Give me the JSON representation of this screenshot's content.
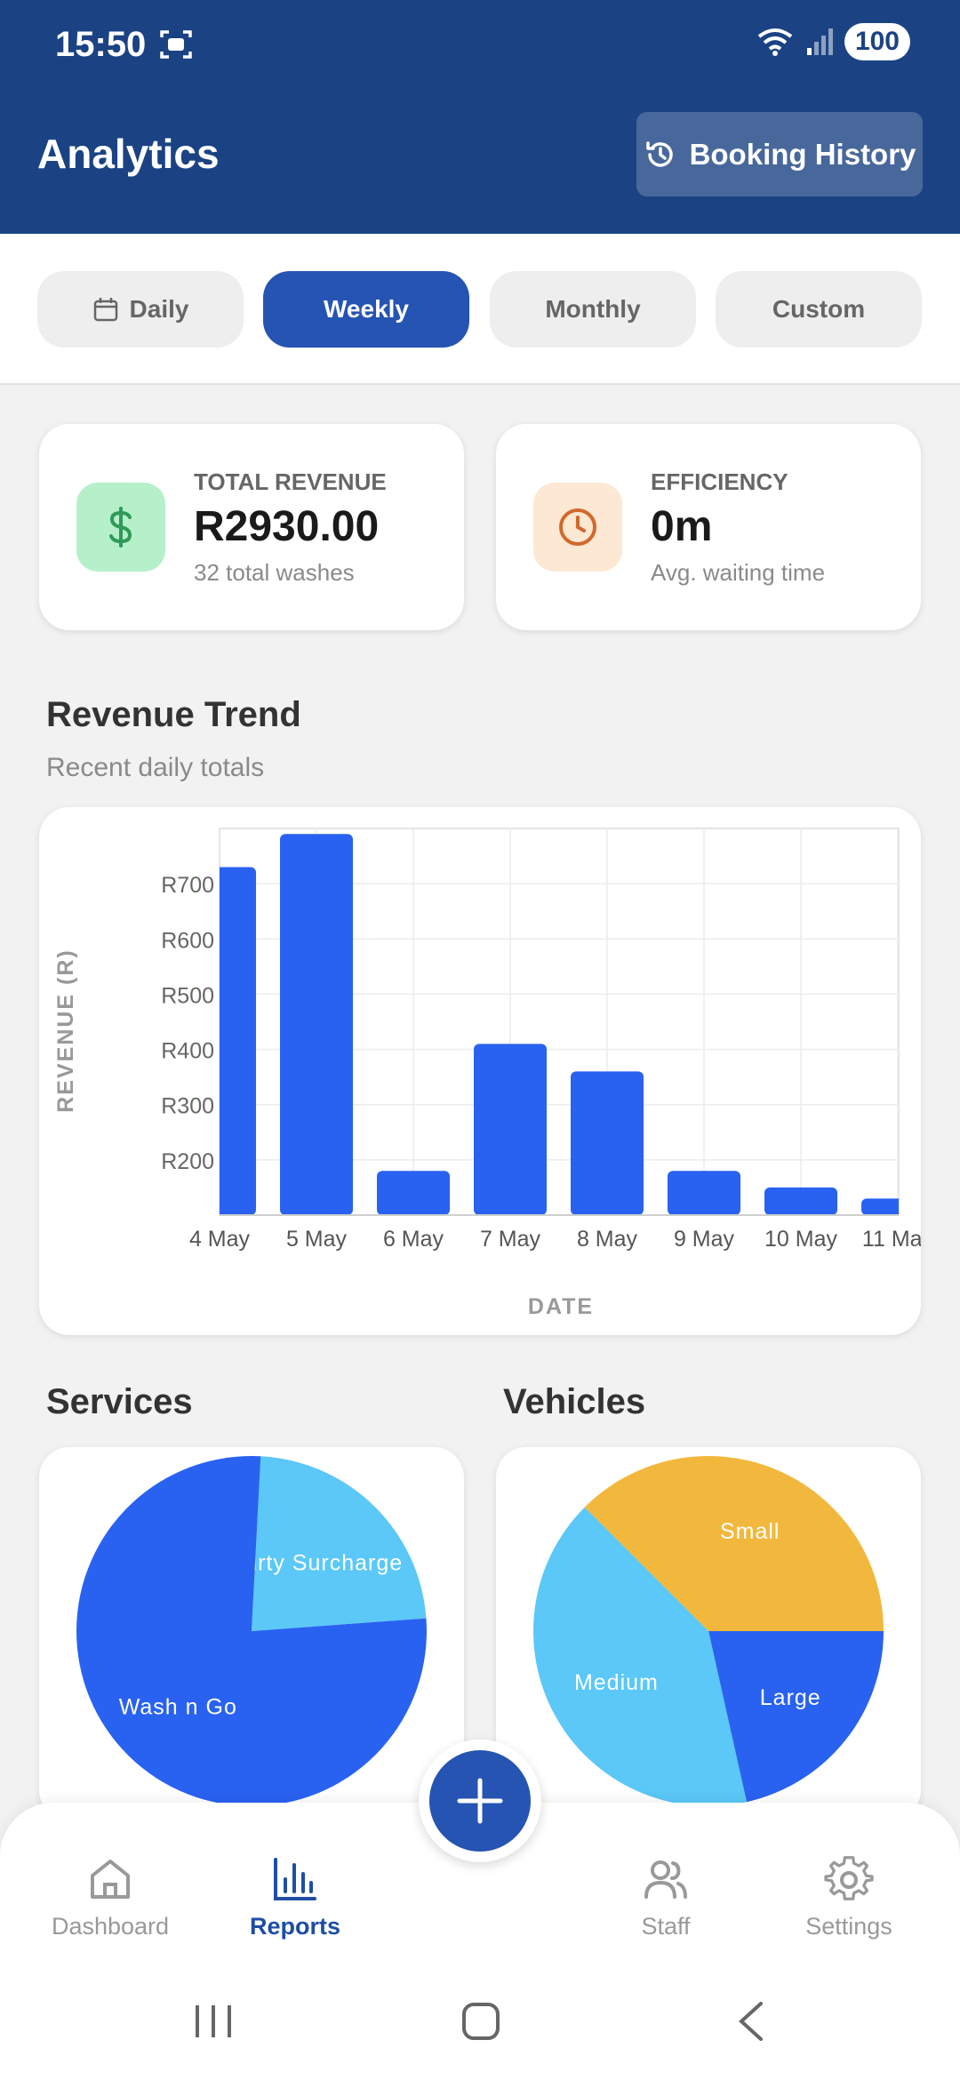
{
  "status_bar": {
    "time": "15:50",
    "battery": "100"
  },
  "header": {
    "title": "Analytics",
    "history_button": "Booking History"
  },
  "tabs": [
    {
      "label": "Daily"
    },
    {
      "label": "Weekly"
    },
    {
      "label": "Monthly"
    },
    {
      "label": "Custom"
    }
  ],
  "stats": {
    "revenue": {
      "label": "TOTAL REVENUE",
      "value": "R2930.00",
      "sub": "32 total washes",
      "icon": "dollar-icon",
      "icon_bg": "#b5f0cb",
      "icon_color": "#2f9a57"
    },
    "efficiency": {
      "label": "EFFICIENCY",
      "value": "0m",
      "sub": "Avg. waiting time",
      "icon": "clock-icon",
      "icon_bg": "#fde8d3",
      "icon_color": "#d2692c"
    }
  },
  "revenue_section": {
    "title": "Revenue Trend",
    "subtitle": "Recent daily totals"
  },
  "services_section": {
    "title": "Services"
  },
  "vehicles_section": {
    "title": "Vehicles"
  },
  "chart_data": [
    {
      "type": "bar",
      "title": "Revenue Trend",
      "xlabel": "DATE",
      "ylabel": "REVENUE (R)",
      "categories": [
        "4 May",
        "5 May",
        "6 May",
        "7 May",
        "8 May",
        "9 May",
        "10 May",
        "11 May"
      ],
      "values": [
        730,
        790,
        180,
        410,
        360,
        180,
        150,
        130
      ],
      "ylim": [
        100,
        800
      ],
      "yticks": [
        200,
        300,
        400,
        500,
        600,
        700
      ],
      "ytick_prefix": "R",
      "grid": true,
      "color": "#2962f0"
    },
    {
      "type": "pie",
      "title": "Services",
      "labels": [
        "Dirty Surcharge",
        "Wash n Go"
      ],
      "values": [
        23,
        77
      ],
      "colors": [
        "#5bc8f7",
        "#2962f0"
      ]
    },
    {
      "type": "pie",
      "title": "Vehicles",
      "labels": [
        "Small",
        "Large",
        "Medium"
      ],
      "values": [
        37.5,
        21.5,
        41
      ],
      "colors": [
        "#f2b83d",
        "#2962f0",
        "#5bc8f7"
      ]
    }
  ],
  "bottom_nav": [
    {
      "label": "Dashboard",
      "icon": "home-icon"
    },
    {
      "label": "Reports",
      "icon": "bar-chart-icon"
    },
    {
      "label": "Staff",
      "icon": "users-icon"
    },
    {
      "label": "Settings",
      "icon": "gear-icon"
    }
  ],
  "colors": {
    "primary": "#1b4383",
    "accent": "#2554b2",
    "bar": "#2962f0"
  }
}
